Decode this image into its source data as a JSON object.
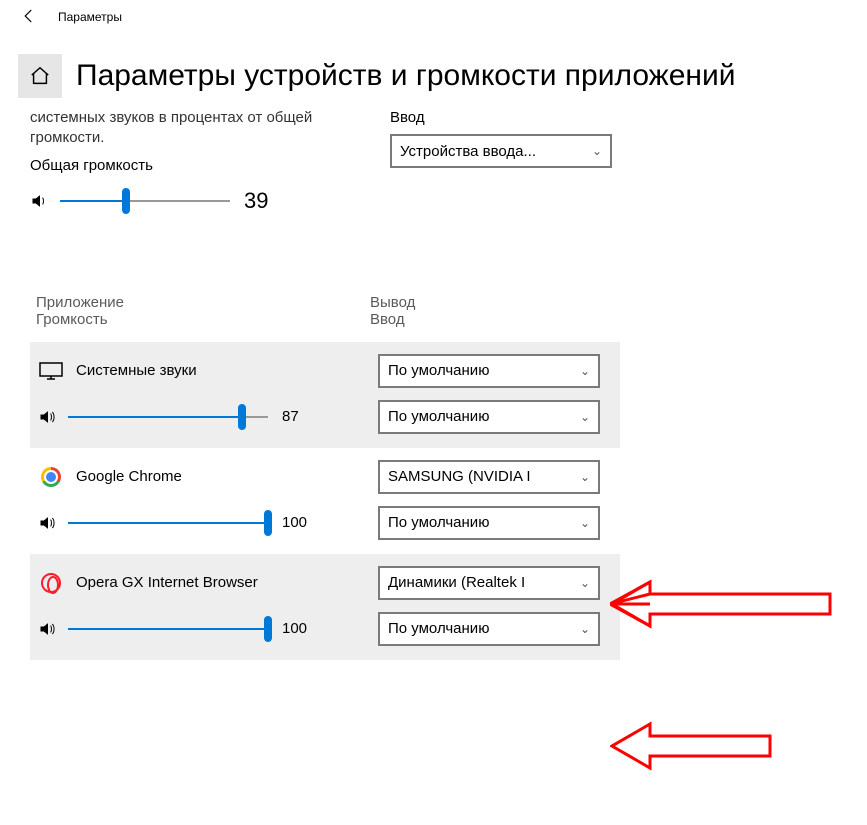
{
  "window": {
    "title": "Параметры"
  },
  "page_title": "Параметры устройств и громкости приложений",
  "description": "системных звуков в процентах от общей громкости.",
  "master_label": "Общая громкость",
  "master_value": "39",
  "master_percent": 39,
  "input_section": {
    "label": "Ввод",
    "device": "Устройства ввода..."
  },
  "columns": {
    "left1": "Приложение",
    "left2": "Громкость",
    "right1": "Вывод",
    "right2": "Ввод"
  },
  "default_text": "По умолчанию",
  "apps": [
    {
      "name": "Системные звуки",
      "icon": "monitor",
      "volume": 87,
      "volume_text": "87",
      "output": "По умолчанию",
      "input": "По умолчанию",
      "shaded": true
    },
    {
      "name": "Google Chrome",
      "icon": "chrome",
      "volume": 100,
      "volume_text": "100",
      "output": "SAMSUNG (NVIDIA I",
      "input": "По умолчанию",
      "shaded": false
    },
    {
      "name": "Opera GX Internet Browser",
      "icon": "opera",
      "volume": 100,
      "volume_text": "100",
      "output": "Динамики (Realtek I",
      "input": "По умолчанию",
      "shaded": true
    }
  ]
}
